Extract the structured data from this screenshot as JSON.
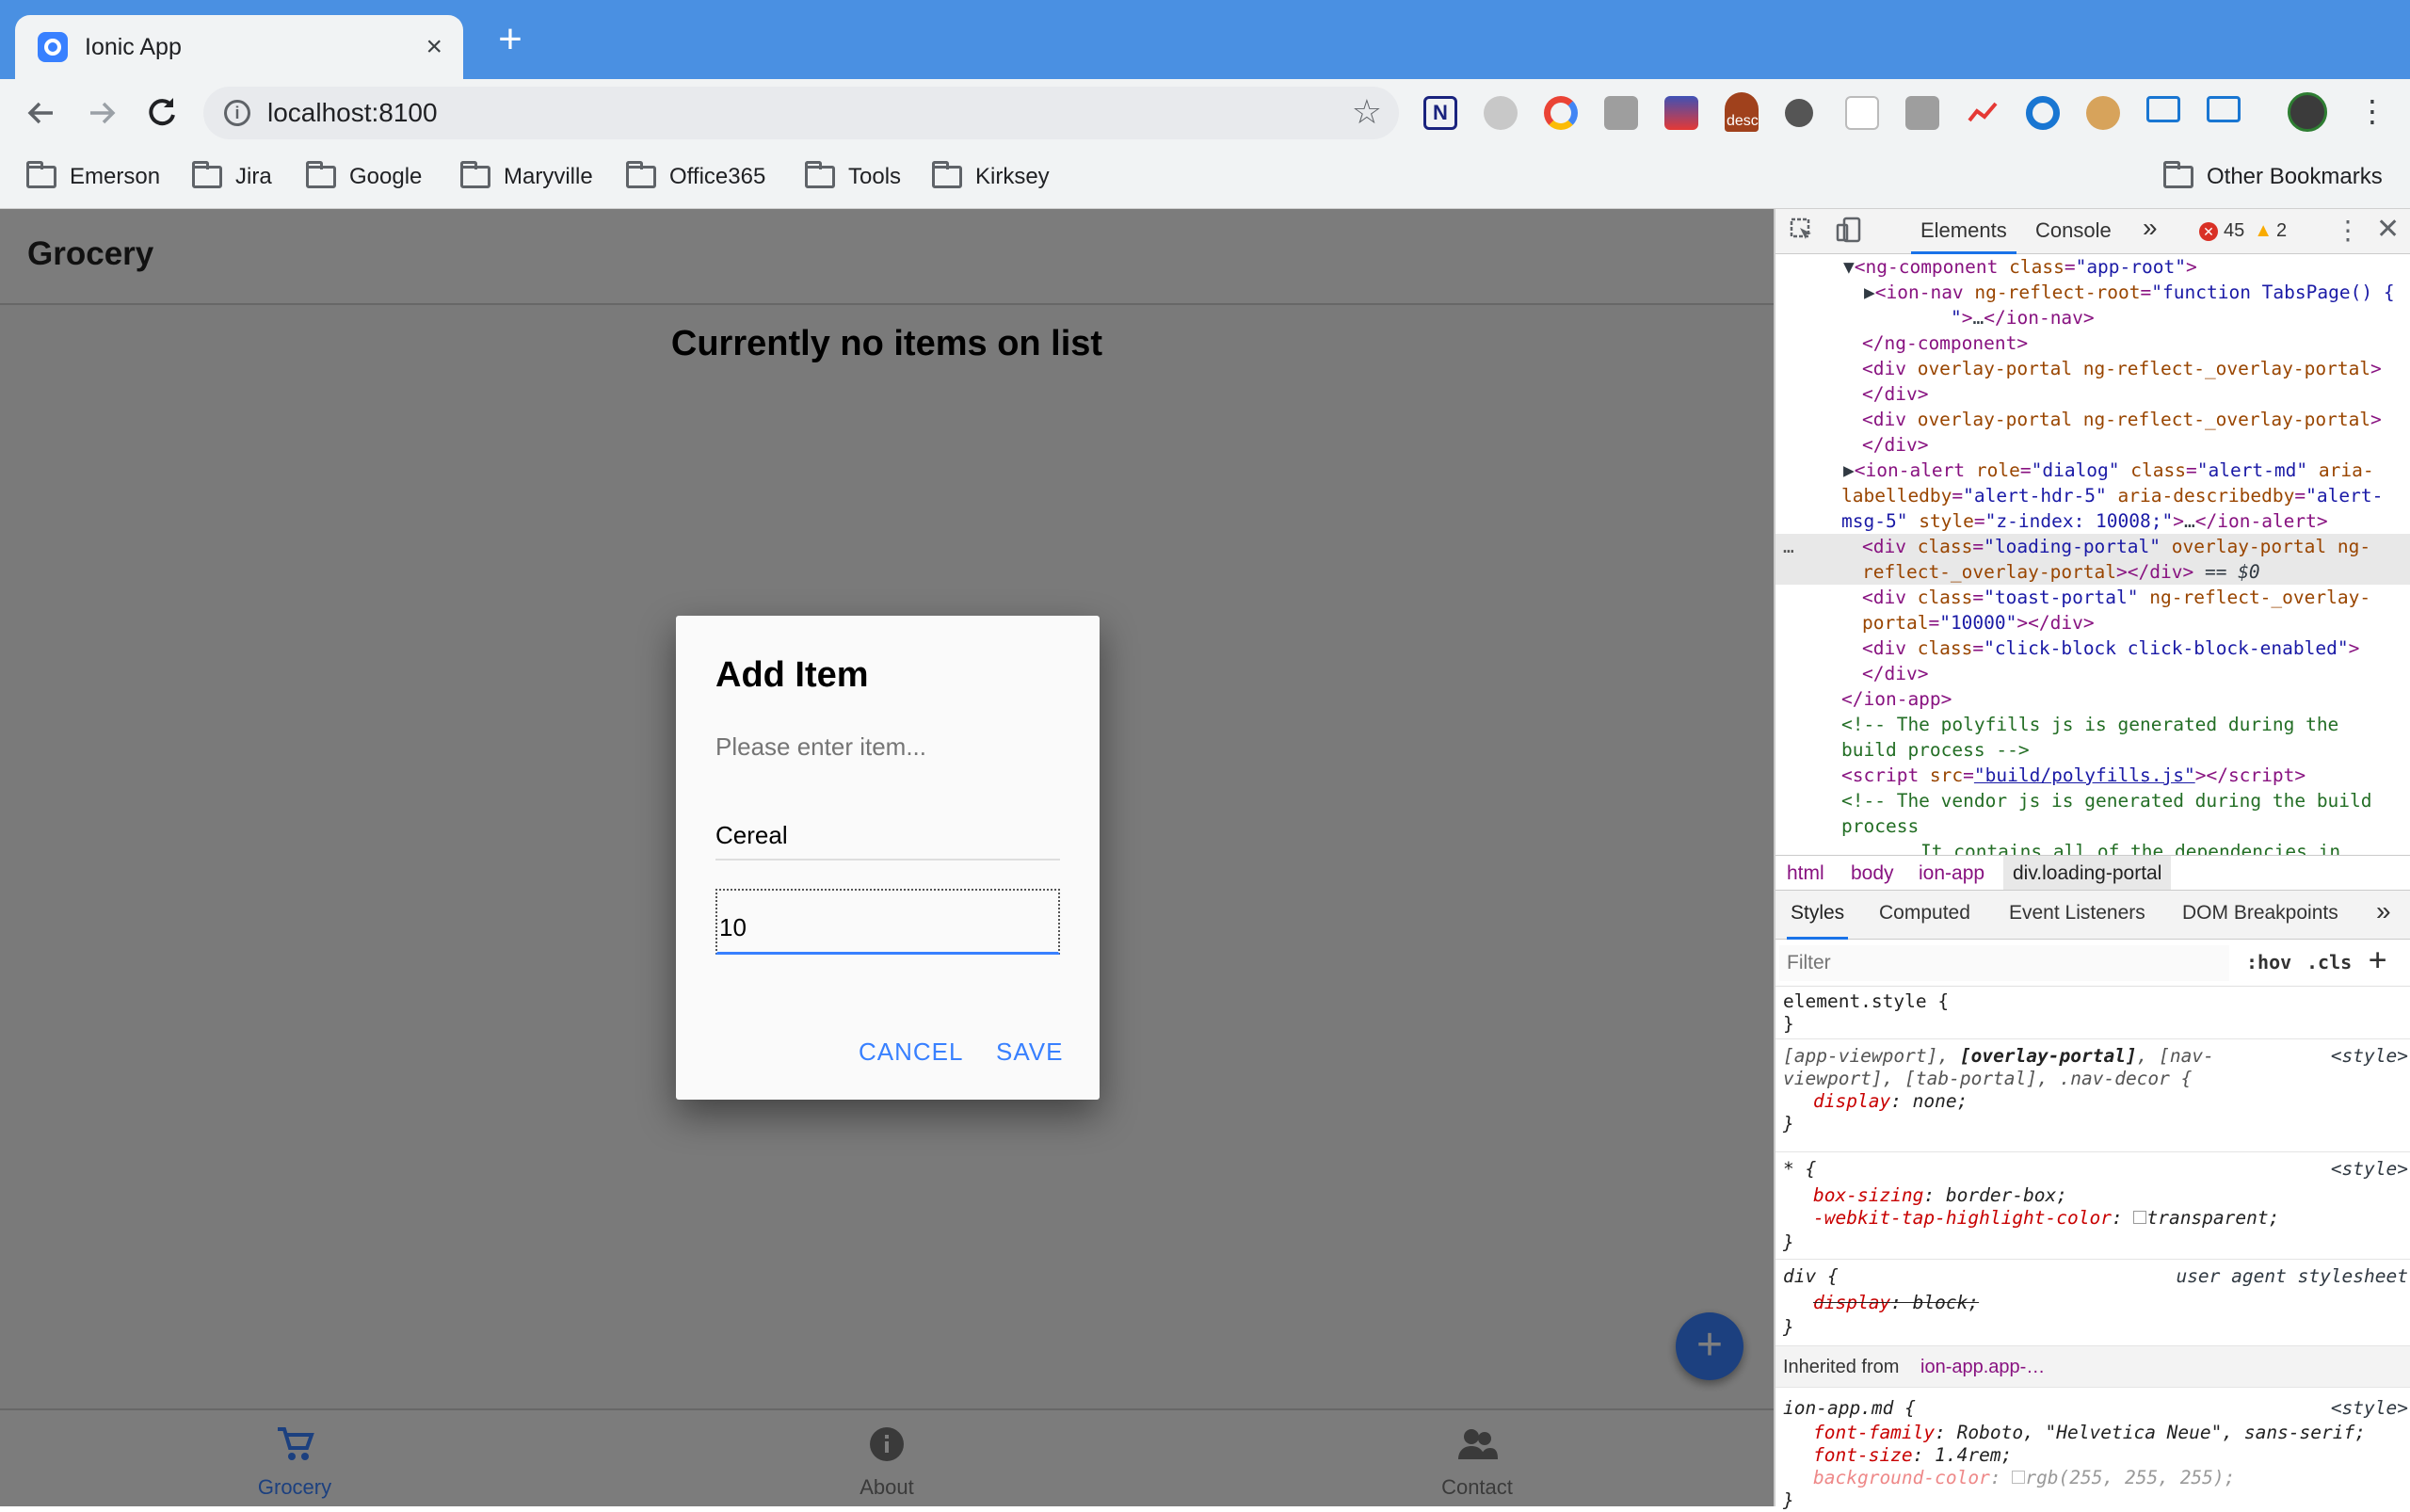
{
  "browser": {
    "tab_title": "Ionic App",
    "tab_close": "×",
    "new_tab": "+",
    "url": "localhost:8100",
    "ext_badge": "desc",
    "bookmarks": [
      "Emerson",
      "Jira",
      "Google",
      "Maryville",
      "Office365",
      "Tools",
      "Kirksey"
    ],
    "other_bookmarks": "Other Bookmarks"
  },
  "app": {
    "title": "Grocery",
    "empty_message": "Currently no items on list",
    "tabs": [
      {
        "label": "Grocery",
        "icon": "cart-icon",
        "active": true
      },
      {
        "label": "About",
        "icon": "info-icon",
        "active": false
      },
      {
        "label": "Contact",
        "icon": "contacts-icon",
        "active": false
      }
    ],
    "fab": "+",
    "accent": "#3880ff"
  },
  "alert": {
    "header": "Add Item",
    "message": "Please enter item...",
    "name_value": "Cereal",
    "quantity_value": "10",
    "cancel": "CANCEL",
    "save": "SAVE"
  },
  "devtools": {
    "tabs": [
      "Elements",
      "Console"
    ],
    "more": "»",
    "errors": "45",
    "warnings": "2",
    "crumbs": [
      "html",
      "body",
      "ion-app",
      "div.loading-portal"
    ],
    "style_tabs": [
      "Styles",
      "Computed",
      "Event Listeners",
      "DOM Breakpoints"
    ],
    "filter_placeholder": "Filter",
    "hov": ":hov",
    "cls": ".cls",
    "inherited_label": "Inherited from",
    "inherited_from": "ion-app.app-…"
  }
}
